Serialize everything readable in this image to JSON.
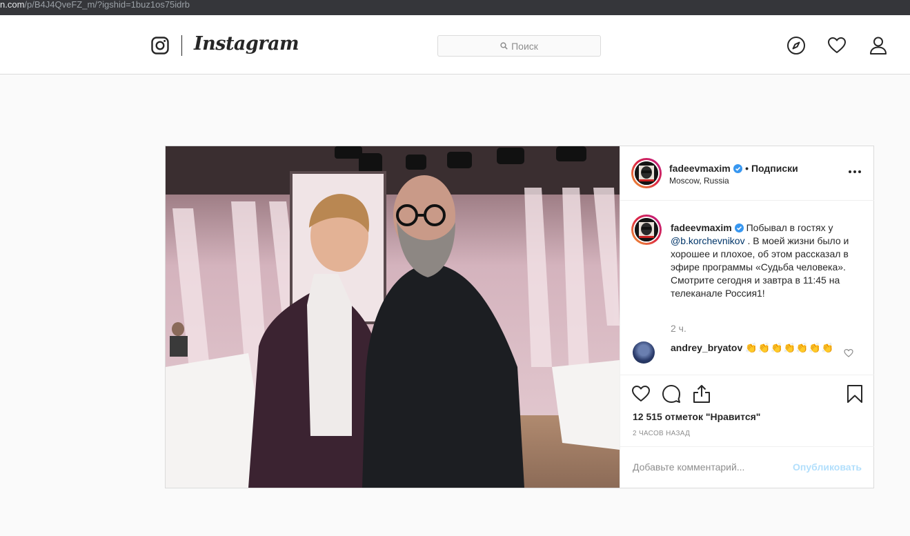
{
  "browser": {
    "url_domain": "n.com",
    "url_path": "/p/B4J4QveFZ_m/?igshid=1buz1os75idrb"
  },
  "header": {
    "logo_text": "Instagram",
    "search_placeholder": "Поиск",
    "icons": [
      "instagram-camera-icon",
      "compass-icon",
      "heart-icon",
      "profile-icon"
    ]
  },
  "post": {
    "author": {
      "username": "fadeevmaxim",
      "verified": true,
      "follow_label": "• Подписки",
      "location": "Moscow, Russia"
    },
    "caption": {
      "username": "fadeevmaxim",
      "text_before": "Побывал в гостях у ",
      "mention": "@b.korchevnikov",
      "text_after": " . В моей жизни было и хорошее и плохое, об этом рассказал в эфире программы «Судьба человека». Смотрите сегодня и завтра в 11:45 на телеканале Россия1!",
      "time": "2 ч."
    },
    "comments": [
      {
        "username": "andrey_bryatov",
        "text": "👏👏👏👏👏👏👏"
      }
    ],
    "likes": "12 515 отметок \"Нравится\"",
    "posted_ago": "2 часов назад",
    "comment_placeholder": "Добавьте комментарий...",
    "publish_label": "Опубликовать"
  },
  "colors": {
    "background": "#fafafa",
    "border": "#dbdbdb",
    "verified_blue": "#3897f0",
    "mention": "#003569",
    "publish_disabled": "#b2dffc",
    "muted_text": "#8e8e8e"
  }
}
